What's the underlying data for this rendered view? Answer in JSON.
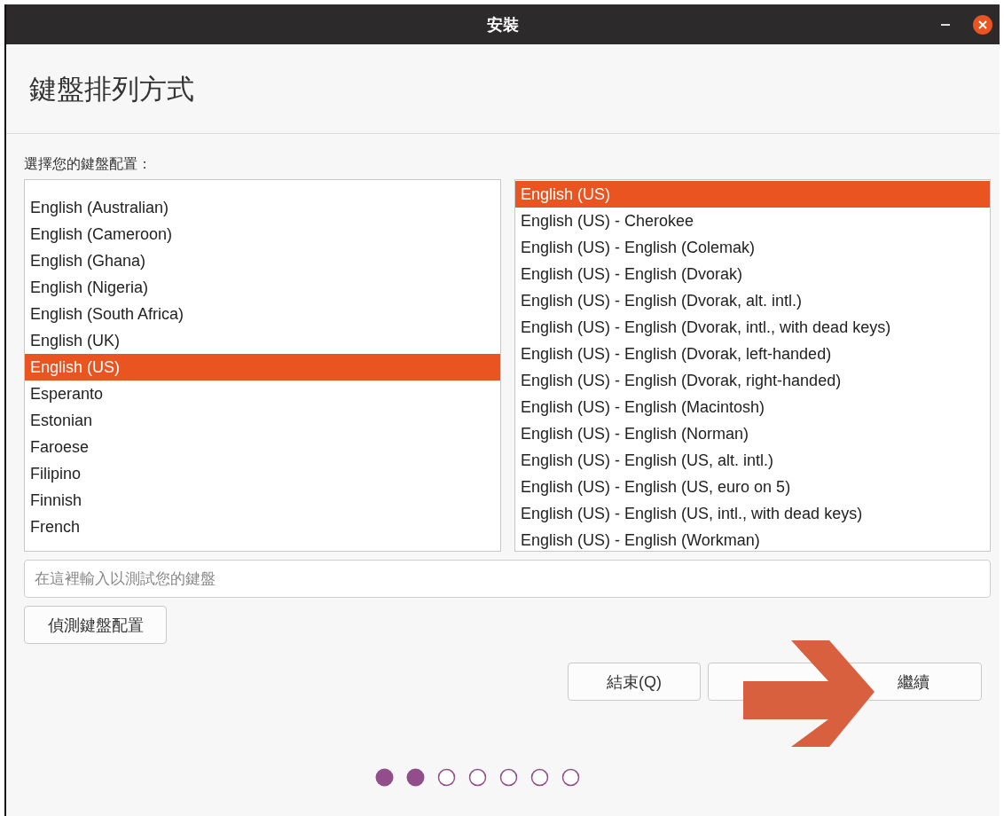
{
  "window": {
    "title": "安裝"
  },
  "page_title": "鍵盤排列方式",
  "layout_label": "選擇您的鍵盤配置：",
  "layouts": [
    {
      "label": "English (Australian)",
      "selected": false
    },
    {
      "label": "English (Cameroon)",
      "selected": false
    },
    {
      "label": "English (Ghana)",
      "selected": false
    },
    {
      "label": "English (Nigeria)",
      "selected": false
    },
    {
      "label": "English (South Africa)",
      "selected": false
    },
    {
      "label": "English (UK)",
      "selected": false
    },
    {
      "label": "English (US)",
      "selected": true
    },
    {
      "label": "Esperanto",
      "selected": false
    },
    {
      "label": "Estonian",
      "selected": false
    },
    {
      "label": "Faroese",
      "selected": false
    },
    {
      "label": "Filipino",
      "selected": false
    },
    {
      "label": "Finnish",
      "selected": false
    },
    {
      "label": "French",
      "selected": false
    }
  ],
  "variants": [
    {
      "label": "English (US)",
      "selected": true
    },
    {
      "label": "English (US) - Cherokee",
      "selected": false
    },
    {
      "label": "English (US) - English (Colemak)",
      "selected": false
    },
    {
      "label": "English (US) - English (Dvorak)",
      "selected": false
    },
    {
      "label": "English (US) - English (Dvorak, alt. intl.)",
      "selected": false
    },
    {
      "label": "English (US) - English (Dvorak, intl., with dead keys)",
      "selected": false
    },
    {
      "label": "English (US) - English (Dvorak, left-handed)",
      "selected": false
    },
    {
      "label": "English (US) - English (Dvorak, right-handed)",
      "selected": false
    },
    {
      "label": "English (US) - English (Macintosh)",
      "selected": false
    },
    {
      "label": "English (US) - English (Norman)",
      "selected": false
    },
    {
      "label": "English (US) - English (US, alt. intl.)",
      "selected": false
    },
    {
      "label": "English (US) - English (US, euro on 5)",
      "selected": false
    },
    {
      "label": "English (US) - English (US, intl., with dead keys)",
      "selected": false
    },
    {
      "label": "English (US) - English (Workman)",
      "selected": false
    }
  ],
  "test_field": {
    "placeholder": "在這裡輸入以測試您的鍵盤"
  },
  "detect_button": "偵測鍵盤配置",
  "buttons": [
    {
      "label": "結束(Q)"
    },
    {
      "label": "繼續"
    }
  ],
  "progress_steps": [
    {
      "done": true
    },
    {
      "done": true
    },
    {
      "done": false
    },
    {
      "done": false
    },
    {
      "done": false
    },
    {
      "done": false
    },
    {
      "done": false
    }
  ]
}
